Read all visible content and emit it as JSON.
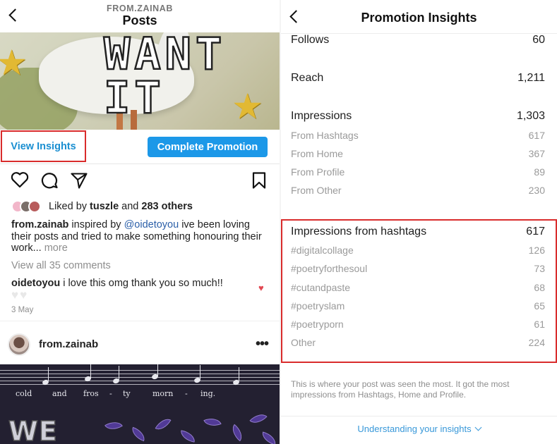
{
  "left": {
    "header": {
      "username": "FROM.ZAINAB",
      "title": "Posts"
    },
    "post_image_text": "WANT IT",
    "view_insights_label": "View Insights",
    "complete_promotion_label": "Complete Promotion",
    "likes": {
      "prefix": "Liked by ",
      "user": "tuszle",
      "middle": " and ",
      "count": "283 others"
    },
    "caption": {
      "user": "from.zainab",
      "text1": " inspired by ",
      "mention": "@oidetoyou",
      "text2": " ive been loving their posts and tried to make something honouring their work...",
      "more": " more"
    },
    "view_comments": "View all 35 comments",
    "comment": {
      "user": "oidetoyou",
      "text": " i love this omg thank you so much!!",
      "hearts": [
        "♥",
        "♥"
      ]
    },
    "date": "3 May",
    "post2": {
      "user": "from.zainab",
      "image_lyrics": [
        "cold",
        "and",
        "fros",
        "-",
        "ty",
        "morn",
        "-",
        "ing."
      ],
      "image_word": "WE"
    }
  },
  "right": {
    "title": "Promotion Insights",
    "follows": {
      "label": "Follows",
      "value": "60"
    },
    "reach": {
      "label": "Reach",
      "value": "1,211"
    },
    "impressions": {
      "label": "Impressions",
      "value": "1,303",
      "breakdown": [
        {
          "label": "From Hashtags",
          "value": "617"
        },
        {
          "label": "From Home",
          "value": "367"
        },
        {
          "label": "From Profile",
          "value": "89"
        },
        {
          "label": "From Other",
          "value": "230"
        }
      ]
    },
    "hashtag_impressions": {
      "label": "Impressions from hashtags",
      "value": "617",
      "items": [
        {
          "label": "#digitalcollage",
          "value": "126"
        },
        {
          "label": "#poetryforthesoul",
          "value": "73"
        },
        {
          "label": "#cutandpaste",
          "value": "68"
        },
        {
          "label": "#poetryslam",
          "value": "65"
        },
        {
          "label": "#poetryporn",
          "value": "61"
        },
        {
          "label": "Other",
          "value": "224"
        }
      ]
    },
    "footnote": "This is where your post was seen the most. It got the most impressions from Hashtags, Home and Profile.",
    "understanding_link": "Understanding your insights"
  },
  "colors": {
    "accent_blue": "#1c98e8",
    "link_blue": "#3898d9",
    "highlight_red": "#d92c2c",
    "like_red": "#e24852"
  },
  "icons": [
    "back-chevron-icon",
    "heart-icon",
    "comment-icon",
    "share-icon",
    "bookmark-icon",
    "more-icon",
    "chevron-down-icon"
  ]
}
